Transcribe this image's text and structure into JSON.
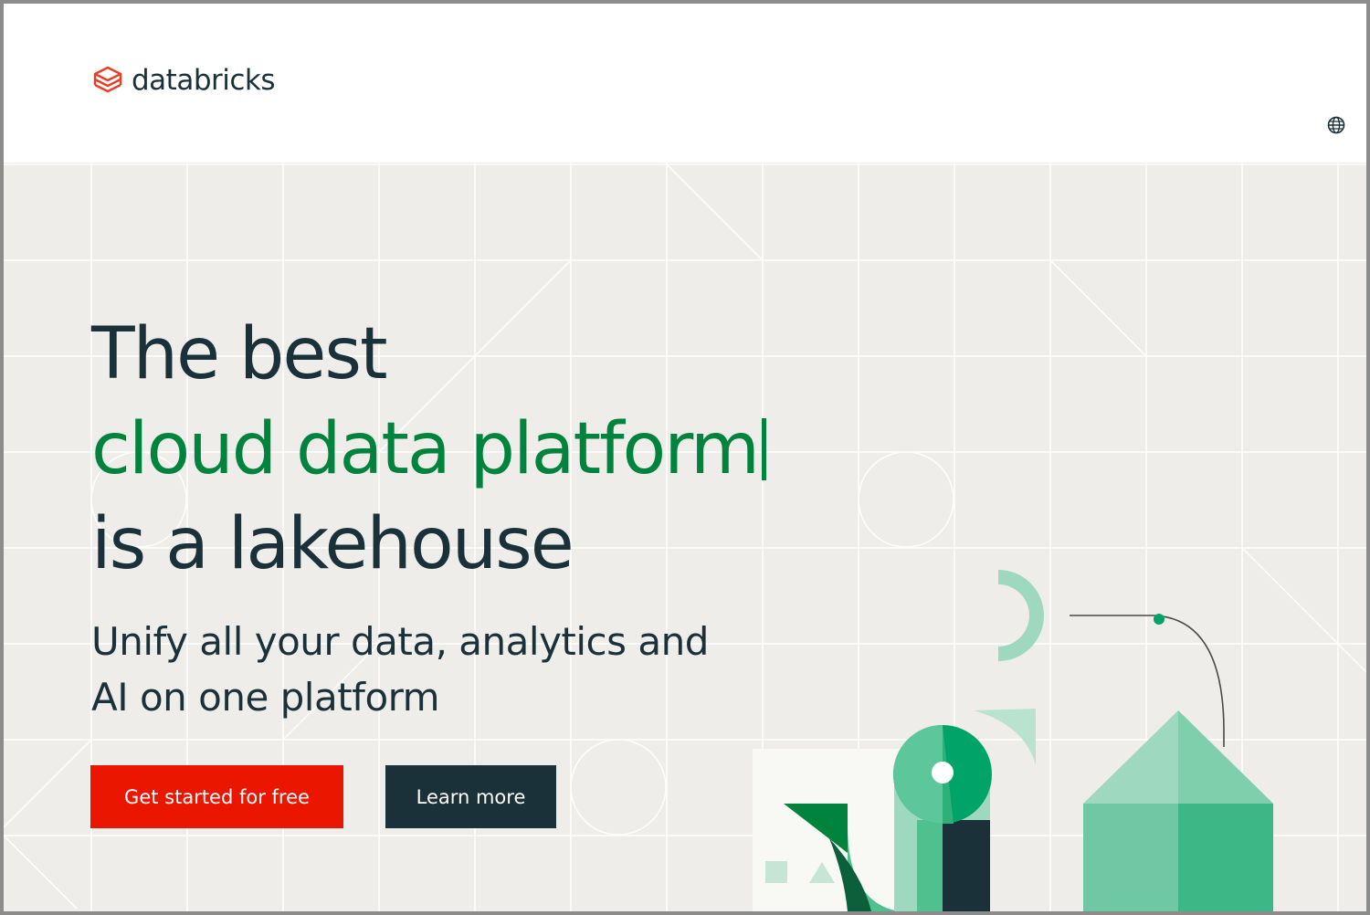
{
  "header": {
    "brand_name": "databricks",
    "language_icon": "globe-icon"
  },
  "hero": {
    "headline_line1": "The best",
    "headline_line2": "cloud data platform",
    "headline_line3": "is a lakehouse",
    "subhead_line1": "Unify all your data, analytics and",
    "subhead_line2": "AI on one platform",
    "primary_cta": "Get started for free",
    "secondary_cta": "Learn more"
  },
  "colors": {
    "brand_red": "#eb1600",
    "accent_green": "#00843d",
    "navy": "#1b3139",
    "hero_background": "#eeede9"
  }
}
